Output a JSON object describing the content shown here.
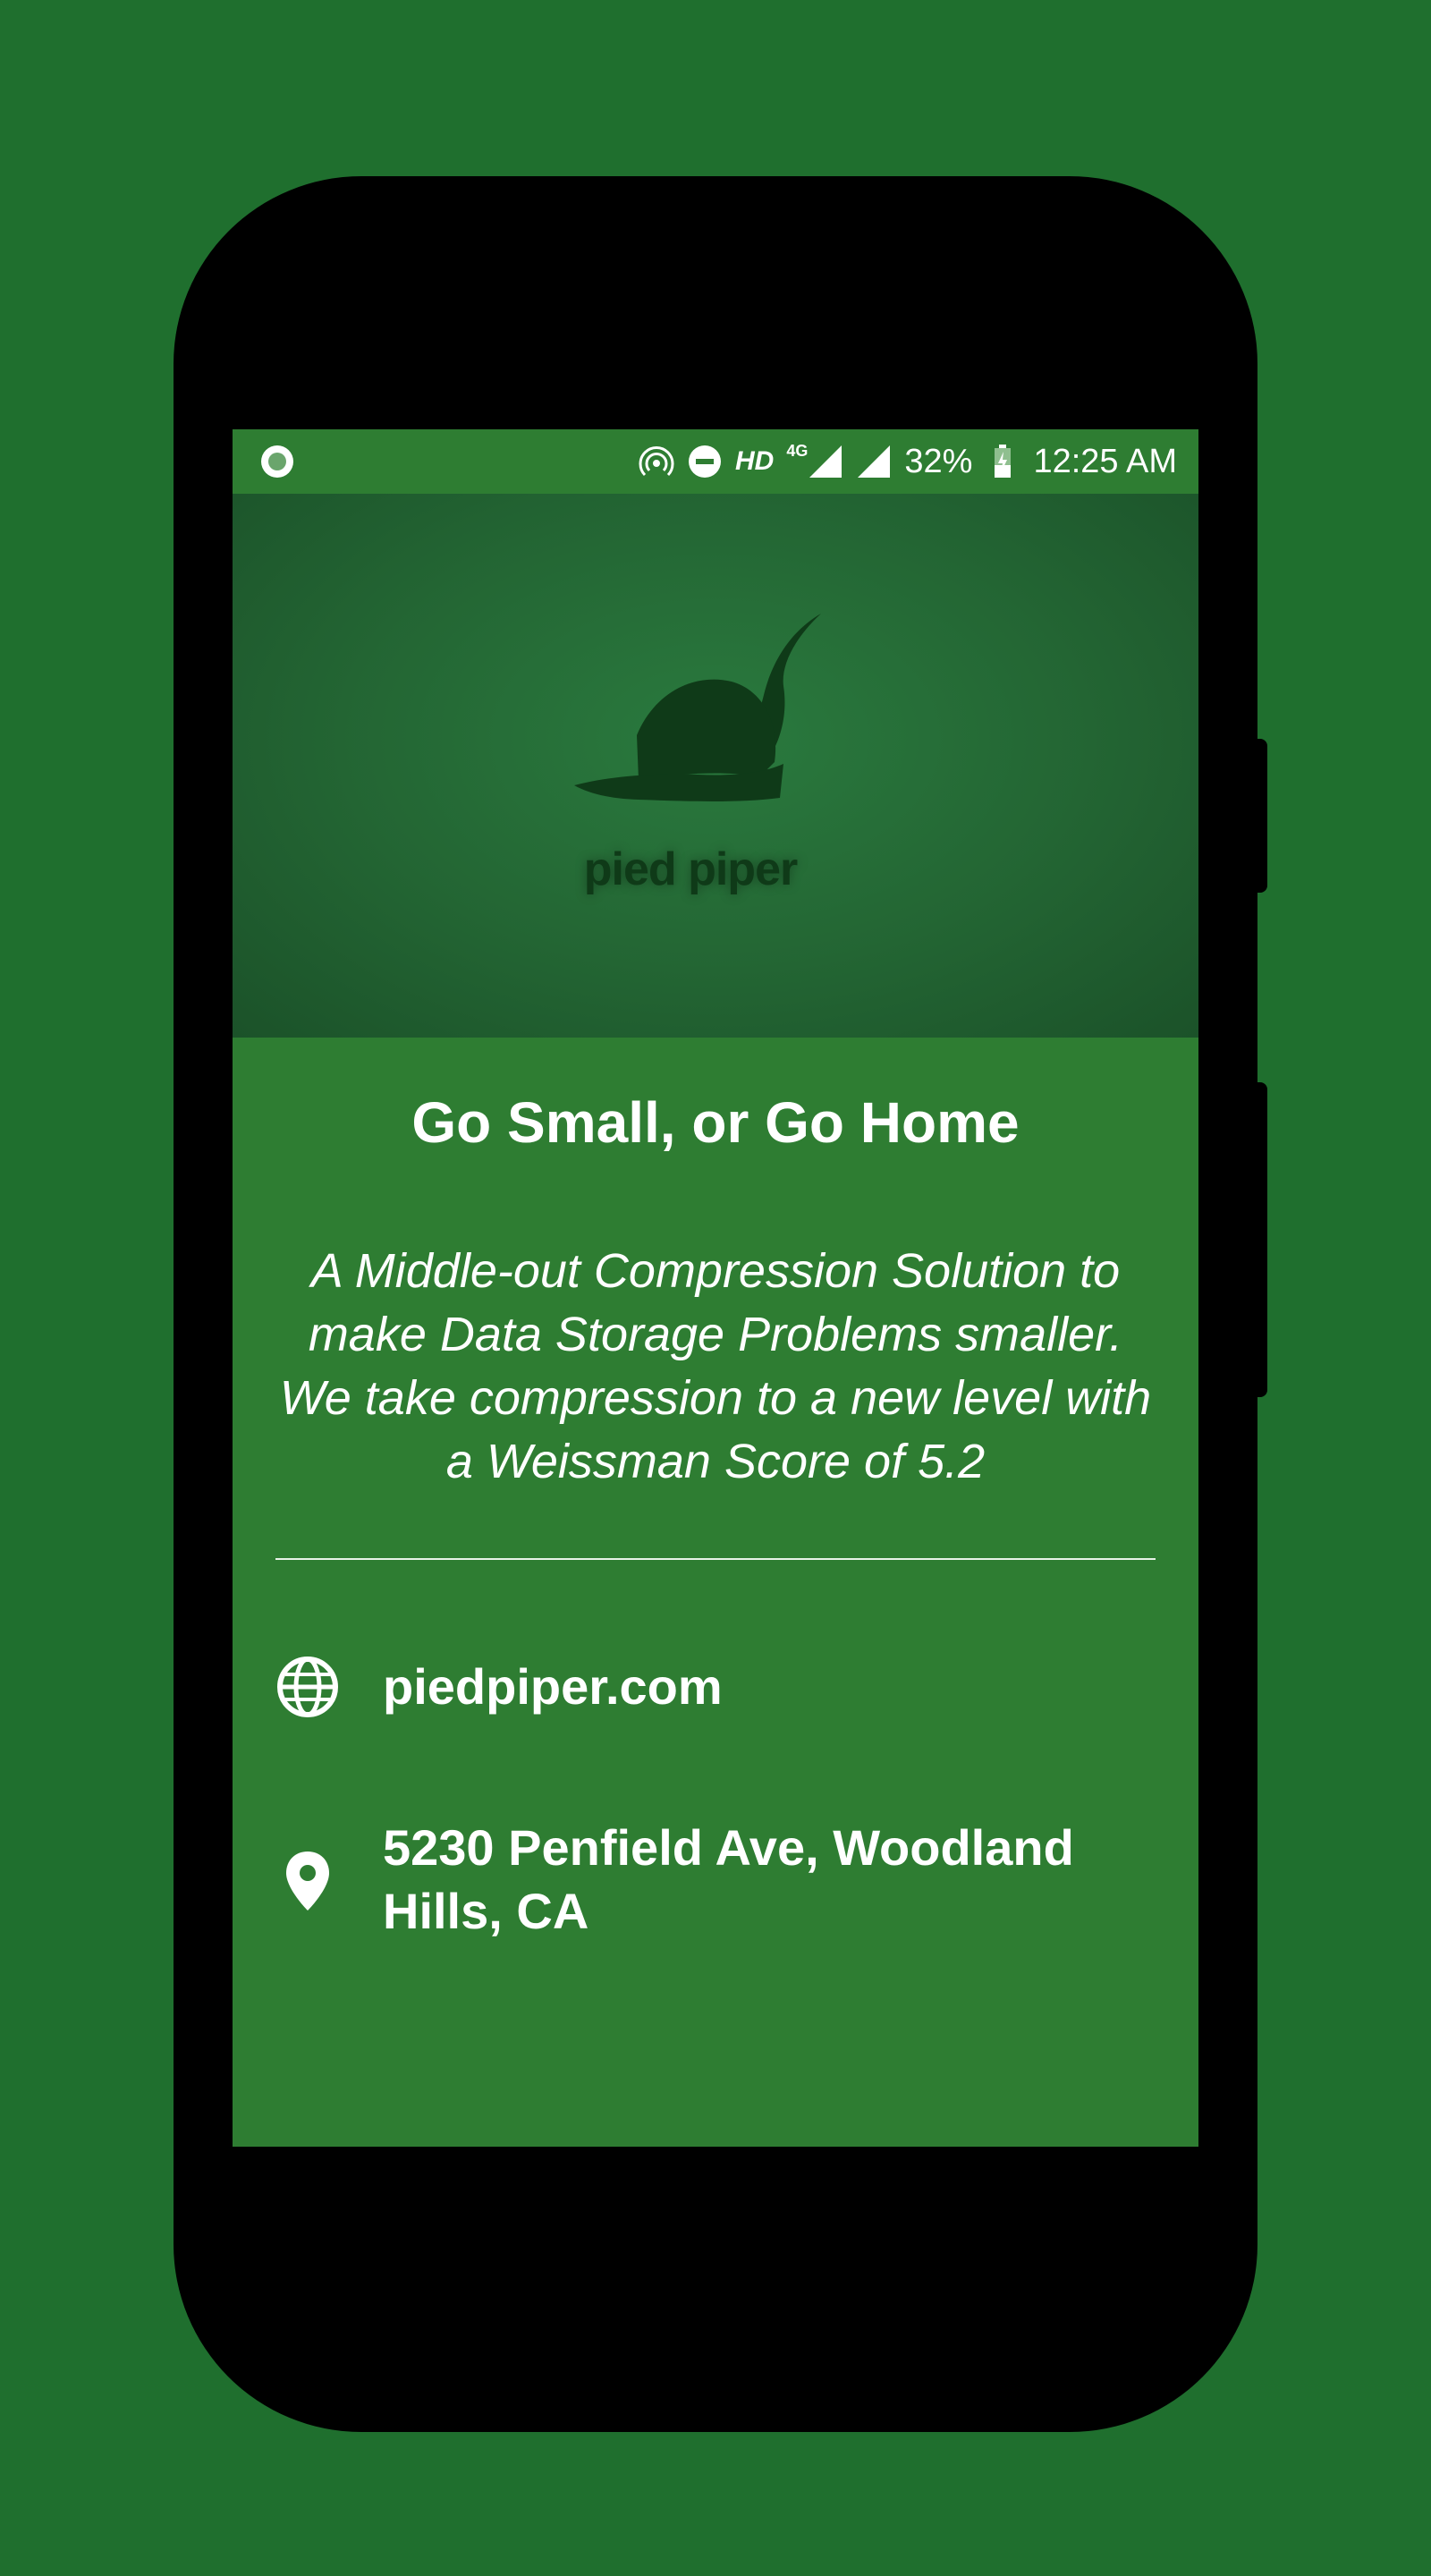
{
  "colors": {
    "background": "#1f6f2e",
    "screen": "#2e7d32",
    "hero": "#236533",
    "text": "#ffffff"
  },
  "status_bar": {
    "left_icon": "status-dot-icon",
    "icons": [
      "hotspot-icon",
      "dnd-icon",
      "signal-icon",
      "battery-icon"
    ],
    "hd_label": "HD",
    "network_label": "4G",
    "battery_percent": "32%",
    "time": "12:25 AM"
  },
  "hero": {
    "logo_icon": "pied-piper-hat-icon",
    "logo_text": "pied piper"
  },
  "main": {
    "headline": "Go Small, or Go Home",
    "tagline": "A Middle-out Compression Solution to make Data Storage Problems smaller. We take compression to a new level with a Weissman Score of 5.2"
  },
  "contacts": [
    {
      "icon": "globe-icon",
      "label": "piedpiper.com"
    },
    {
      "icon": "location-pin-icon",
      "label": "5230 Penfield Ave, Woodland Hills, CA"
    }
  ]
}
